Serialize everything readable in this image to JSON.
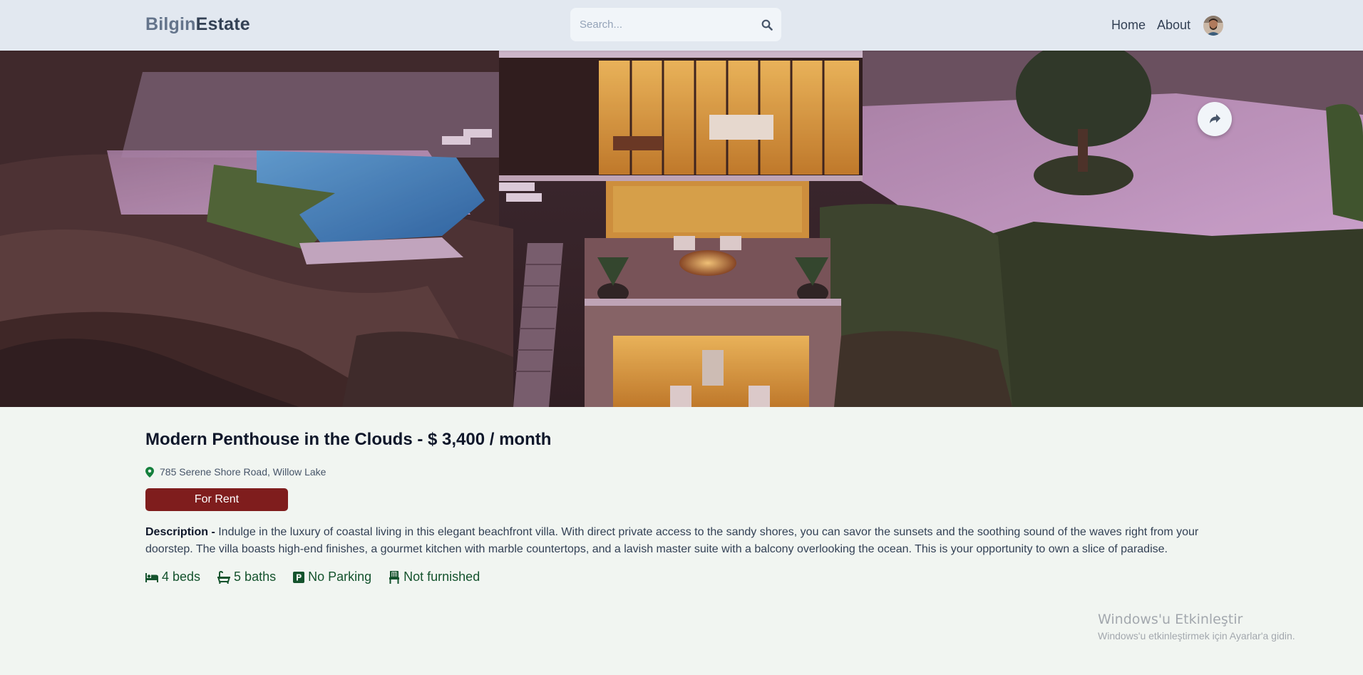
{
  "header": {
    "logo_part1": "Bilgin",
    "logo_part2": "Estate",
    "search_placeholder": "Search...",
    "nav": {
      "home": "Home",
      "about": "About"
    }
  },
  "listing": {
    "title": "Modern Penthouse in the Clouds - $ 3,400 / month",
    "address": "785 Serene Shore Road, Willow Lake",
    "badge": "For Rent",
    "description_label": "Description - ",
    "description": "Indulge in the luxury of coastal living in this elegant beachfront villa. With direct private access to the sandy shores, you can savor the sunsets and the soothing sound of the waves right from your doorstep. The villa boasts high-end finishes, a gourmet kitchen with marble countertops, and a lavish master suite with a balcony overlooking the ocean. This is your opportunity to own a slice of paradise.",
    "features": {
      "beds": "4 beds",
      "baths": "5 baths",
      "parking": "No Parking",
      "furnished": "Not furnished"
    }
  },
  "watermark": {
    "line1": "Windows'u Etkinleştir",
    "line2": "Windows'u etkinleştirmek için Ayarlar'a gidin."
  },
  "colors": {
    "header_bg": "#e2e8f0",
    "page_bg": "#f1f5f1",
    "badge_bg": "#7f1d1d",
    "feature_text": "#14532d",
    "location_pin": "#15803d"
  },
  "icons": {
    "search": "search-icon",
    "share": "share-icon",
    "location": "location-pin-icon",
    "beds": "bed-icon",
    "baths": "bath-icon",
    "parking": "parking-icon",
    "furnished": "chair-icon"
  }
}
